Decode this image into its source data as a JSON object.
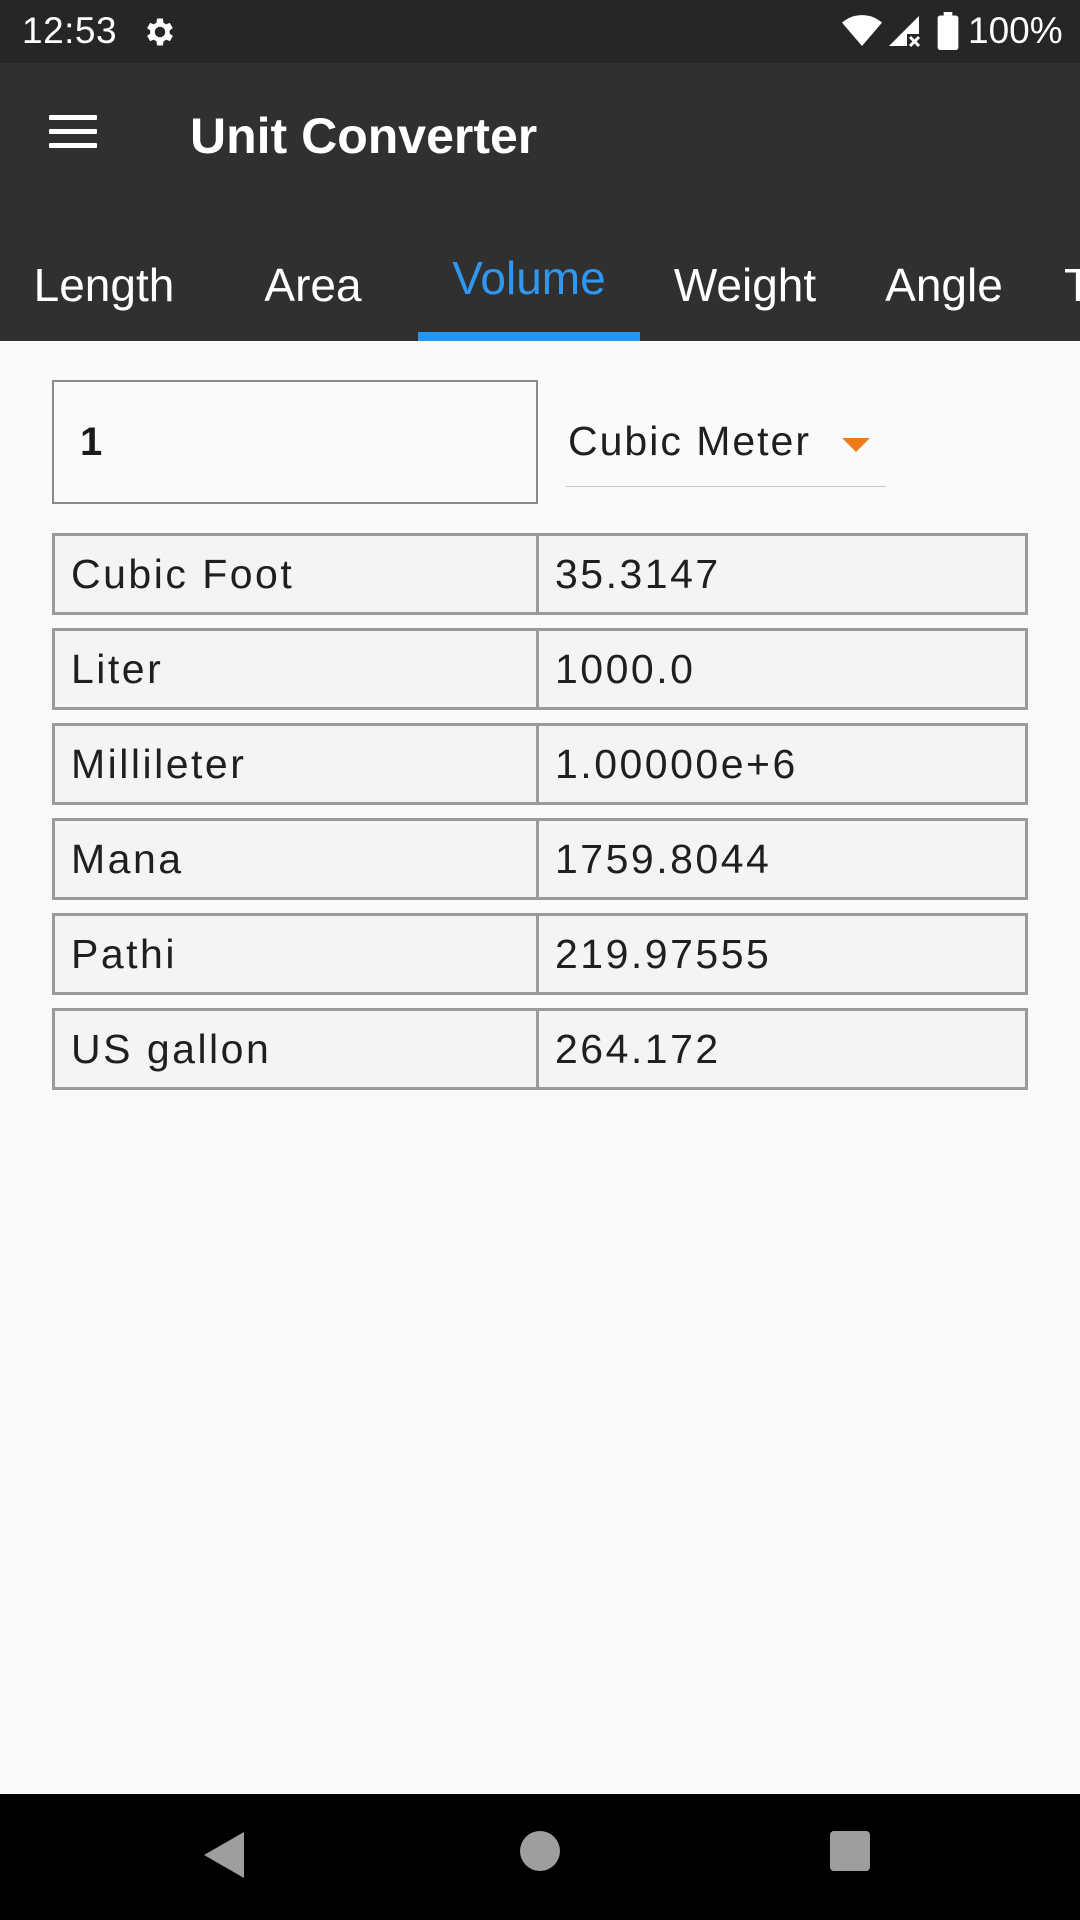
{
  "status_bar": {
    "time": "12:53",
    "battery_text": "100%",
    "icons": [
      "gear-icon",
      "wifi-icon",
      "signal-icon",
      "battery-icon"
    ]
  },
  "app_bar": {
    "title": "Unit Converter",
    "menu_icon": "hamburger-menu-icon"
  },
  "tabs": [
    {
      "label": "Length",
      "active": false
    },
    {
      "label": "Area",
      "active": false
    },
    {
      "label": "Volume",
      "active": true
    },
    {
      "label": "Weight",
      "active": false
    },
    {
      "label": "Angle",
      "active": false
    },
    {
      "label": "T",
      "active": false
    }
  ],
  "converter": {
    "input_value": "1",
    "selected_unit": "Cubic Meter"
  },
  "results": [
    {
      "unit": "Cubic Foot",
      "value": "35.3147"
    },
    {
      "unit": "Liter",
      "value": "1000.0"
    },
    {
      "unit": "Millileter",
      "value": "1.00000e+6"
    },
    {
      "unit": "Mana",
      "value": "1759.8044"
    },
    {
      "unit": "Pathi",
      "value": "219.97555"
    },
    {
      "unit": "US gallon",
      "value": "264.172"
    }
  ],
  "colors": {
    "app_bar": "#303030",
    "status_bar": "#262626",
    "accent": "#2196f3",
    "dropdown_arrow": "#f07d1a"
  },
  "nav_bar": {
    "icons": [
      "back-icon",
      "home-icon",
      "recents-icon"
    ]
  }
}
